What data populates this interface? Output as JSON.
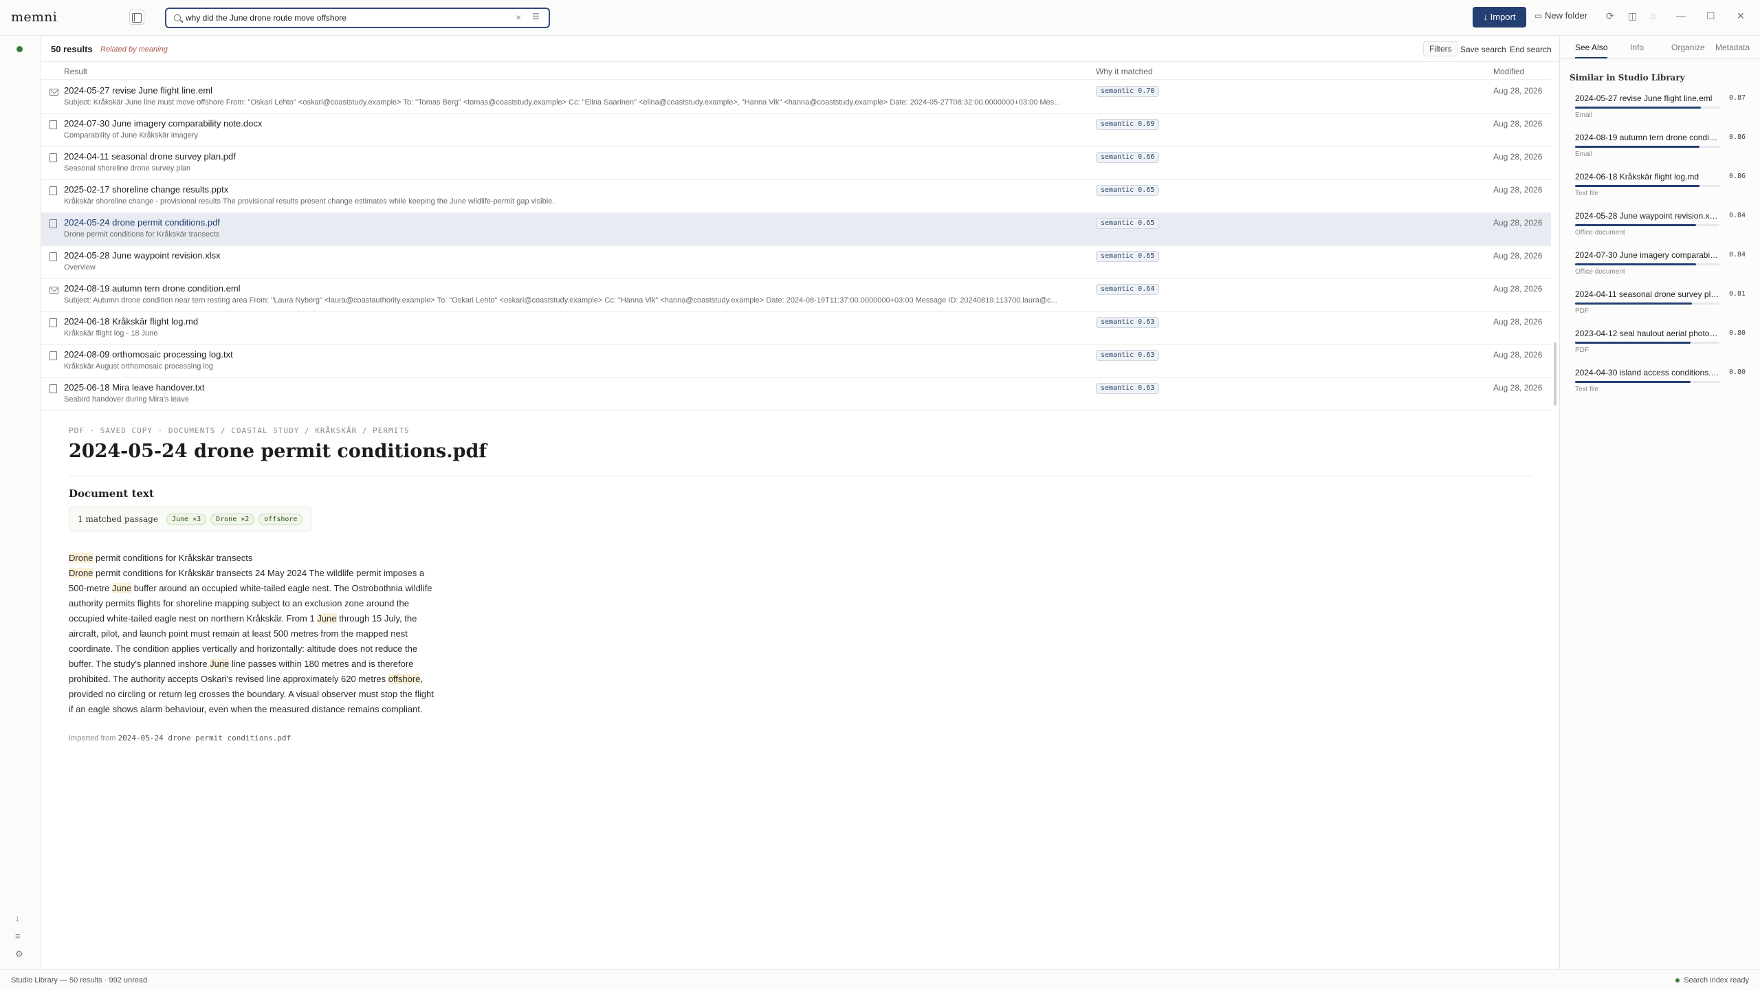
{
  "app": {
    "name": "memni"
  },
  "search": {
    "query": "why did the June drone route move offshore",
    "placeholder": "Search"
  },
  "toolbar": {
    "import_label": "Import",
    "new_folder_label": "New folder"
  },
  "results_header": {
    "count": "50 results",
    "mode": "Related by meaning",
    "filters_label": "Filters",
    "save_search_label": "Save search",
    "end_search_label": "End search"
  },
  "columns": {
    "result": "Result",
    "why": "Why it matched",
    "modified": "Modified"
  },
  "results": [
    {
      "icon": "mail-icon",
      "title": "2024-05-27 revise June flight line.eml",
      "snippet": "Subject: Kråkskär June line must move offshore From: \"Oskari Lehto\" <oskari@coaststudy.example> To: \"Tomas Berg\" <tomas@coaststudy.example> Cc: \"Elina Saarinen\" <elina@coaststudy.example>, \"Hanna Vik\" <hanna@coaststudy.example> Date: 2024-05-27T08:32:00.0000000+03:00 Mes...",
      "badge": "semantic 0.70",
      "modified": "Aug 28, 2026",
      "selected": false
    },
    {
      "icon": "document-icon",
      "title": "2024-07-30 June imagery comparability note.docx",
      "snippet": "Comparability of June Kråkskär imagery",
      "badge": "semantic 0.69",
      "modified": "Aug 28, 2026",
      "selected": false
    },
    {
      "icon": "document-icon",
      "title": "2024-04-11 seasonal drone survey plan.pdf",
      "snippet": "Seasonal shoreline drone survey plan",
      "badge": "semantic 0.66",
      "modified": "Aug 28, 2026",
      "selected": false
    },
    {
      "icon": "document-icon",
      "title": "2025-02-17 shoreline change results.pptx",
      "snippet": "Kråkskär shoreline change - provisional results The provisional results present change estimates while keeping the June wildlife-permit gap visible.",
      "badge": "semantic 0.65",
      "modified": "Aug 28, 2026",
      "selected": false
    },
    {
      "icon": "document-icon",
      "title": "2024-05-24 drone permit conditions.pdf",
      "snippet": "Drone permit conditions for Kråkskär transects",
      "badge": "semantic 0.65",
      "modified": "Aug 28, 2026",
      "selected": true
    },
    {
      "icon": "document-icon",
      "title": "2024-05-28 June waypoint revision.xlsx",
      "snippet": "Overview",
      "badge": "semantic 0.65",
      "modified": "Aug 28, 2026",
      "selected": false
    },
    {
      "icon": "mail-icon",
      "title": "2024-08-19 autumn tern drone condition.eml",
      "snippet": "Subject: Autumn drone condition near tern resting area From: \"Laura Nyberg\" <laura@coastauthority.example> To: \"Oskari Lehto\" <oskari@coaststudy.example> Cc: \"Hanna Vik\" <hanna@coaststudy.example> Date: 2024-08-19T11:37:00.0000000+03:00 Message ID: 20240819.113700.laura@c...",
      "badge": "semantic 0.64",
      "modified": "Aug 28, 2026",
      "selected": false
    },
    {
      "icon": "document-icon",
      "title": "2024-06-18 Kråkskär flight log.md",
      "snippet": "Kråkskär flight log - 18 June",
      "badge": "semantic 0.63",
      "modified": "Aug 28, 2026",
      "selected": false
    },
    {
      "icon": "document-icon",
      "title": "2024-08-09 orthomosaic processing log.txt",
      "snippet": "Kråkskär August orthomosaic processing log",
      "badge": "semantic 0.63",
      "modified": "Aug 28, 2026",
      "selected": false
    },
    {
      "icon": "document-icon",
      "title": "2025-06-18 Mira leave handover.txt",
      "snippet": "Seabird handover during Mira's leave",
      "badge": "semantic 0.63",
      "modified": "Aug 28, 2026",
      "selected": false
    }
  ],
  "preview": {
    "breadcrumb": "PDF · SAVED COPY · DOCUMENTS / COASTAL STUDY / KRÅKSKÄR / PERMITS",
    "title": "2024-05-24 drone permit conditions.pdf",
    "section_heading": "Document text",
    "matched_passage": "1 matched passage",
    "chips": [
      "June ×3",
      "Drone ×2",
      "offshore"
    ],
    "body_segments": [
      {
        "t": "Drone",
        "h": true
      },
      {
        "t": " permit conditions for Kråkskär transects",
        "h": false,
        "br": true
      },
      {
        "t": "Drone",
        "h": true
      },
      {
        "t": " permit conditions for Kråkskär transects 24 May 2024 The wildlife permit imposes a 500-metre ",
        "h": false
      },
      {
        "t": "June",
        "h": true
      },
      {
        "t": " buffer around an occupied white-tailed eagle nest. The Ostrobothnia wildlife authority permits flights for shoreline mapping subject to an exclusion zone around the occupied white-tailed eagle nest on northern Kråkskär. From 1 ",
        "h": false
      },
      {
        "t": "June",
        "h": true
      },
      {
        "t": " through 15 July, the aircraft, pilot, and launch point must remain at least 500 metres from the mapped nest coordinate. The condition applies vertically and horizontally: altitude does not reduce the buffer. The study's planned inshore ",
        "h": false
      },
      {
        "t": "June",
        "h": true
      },
      {
        "t": " line passes within 180 metres and is therefore prohibited. The authority accepts Oskari's revised line approximately 620 metres ",
        "h": false
      },
      {
        "t": "offshore",
        "h": true
      },
      {
        "t": ", provided no circling or return leg crosses the boundary. A visual observer must stop the flight if an eagle shows alarm behaviour, even when the measured distance remains compliant.",
        "h": false
      }
    ],
    "imported_label": "Imported from",
    "imported_file": "2024-05-24 drone permit conditions.pdf"
  },
  "right_panel": {
    "tabs": [
      "See Also",
      "Info",
      "Organize",
      "Metadata"
    ],
    "active_tab": "See Also",
    "similar_heading": "Similar in Studio Library",
    "similar": [
      {
        "title": "2024-05-27 revise June flight line.eml",
        "score": 0.87,
        "score_label": "0.87",
        "type": "Email"
      },
      {
        "title": "2024-08-19 autumn tern drone condition.eml",
        "score": 0.86,
        "score_label": "0.86",
        "type": "Email"
      },
      {
        "title": "2024-06-18 Kråkskär flight log.md",
        "score": 0.86,
        "score_label": "0.86",
        "type": "Text file"
      },
      {
        "title": "2024-05-28 June waypoint revision.xlsx",
        "score": 0.84,
        "score_label": "0.84",
        "type": "Office document"
      },
      {
        "title": "2024-07-30 June imagery comparability note.docx",
        "score": 0.84,
        "score_label": "0.84",
        "type": "Office document"
      },
      {
        "title": "2024-04-11 seasonal drone survey plan.pdf",
        "score": 0.81,
        "score_label": "0.81",
        "type": "PDF"
      },
      {
        "title": "2023-04-12 seal haulout aerial photos.pdf",
        "score": 0.8,
        "score_label": "0.80",
        "type": "PDF"
      },
      {
        "title": "2024-04-30 island access conditions.txt",
        "score": 0.8,
        "score_label": "0.80",
        "type": "Text file"
      }
    ]
  },
  "statusbar": {
    "left": "Studio Library — 50 results · 992 unread",
    "right": "Search index ready"
  },
  "colors": {
    "accent": "#243f72",
    "highlight": "#fbf0d6",
    "ok": "#3c7a3a",
    "related": "#b0564a"
  }
}
